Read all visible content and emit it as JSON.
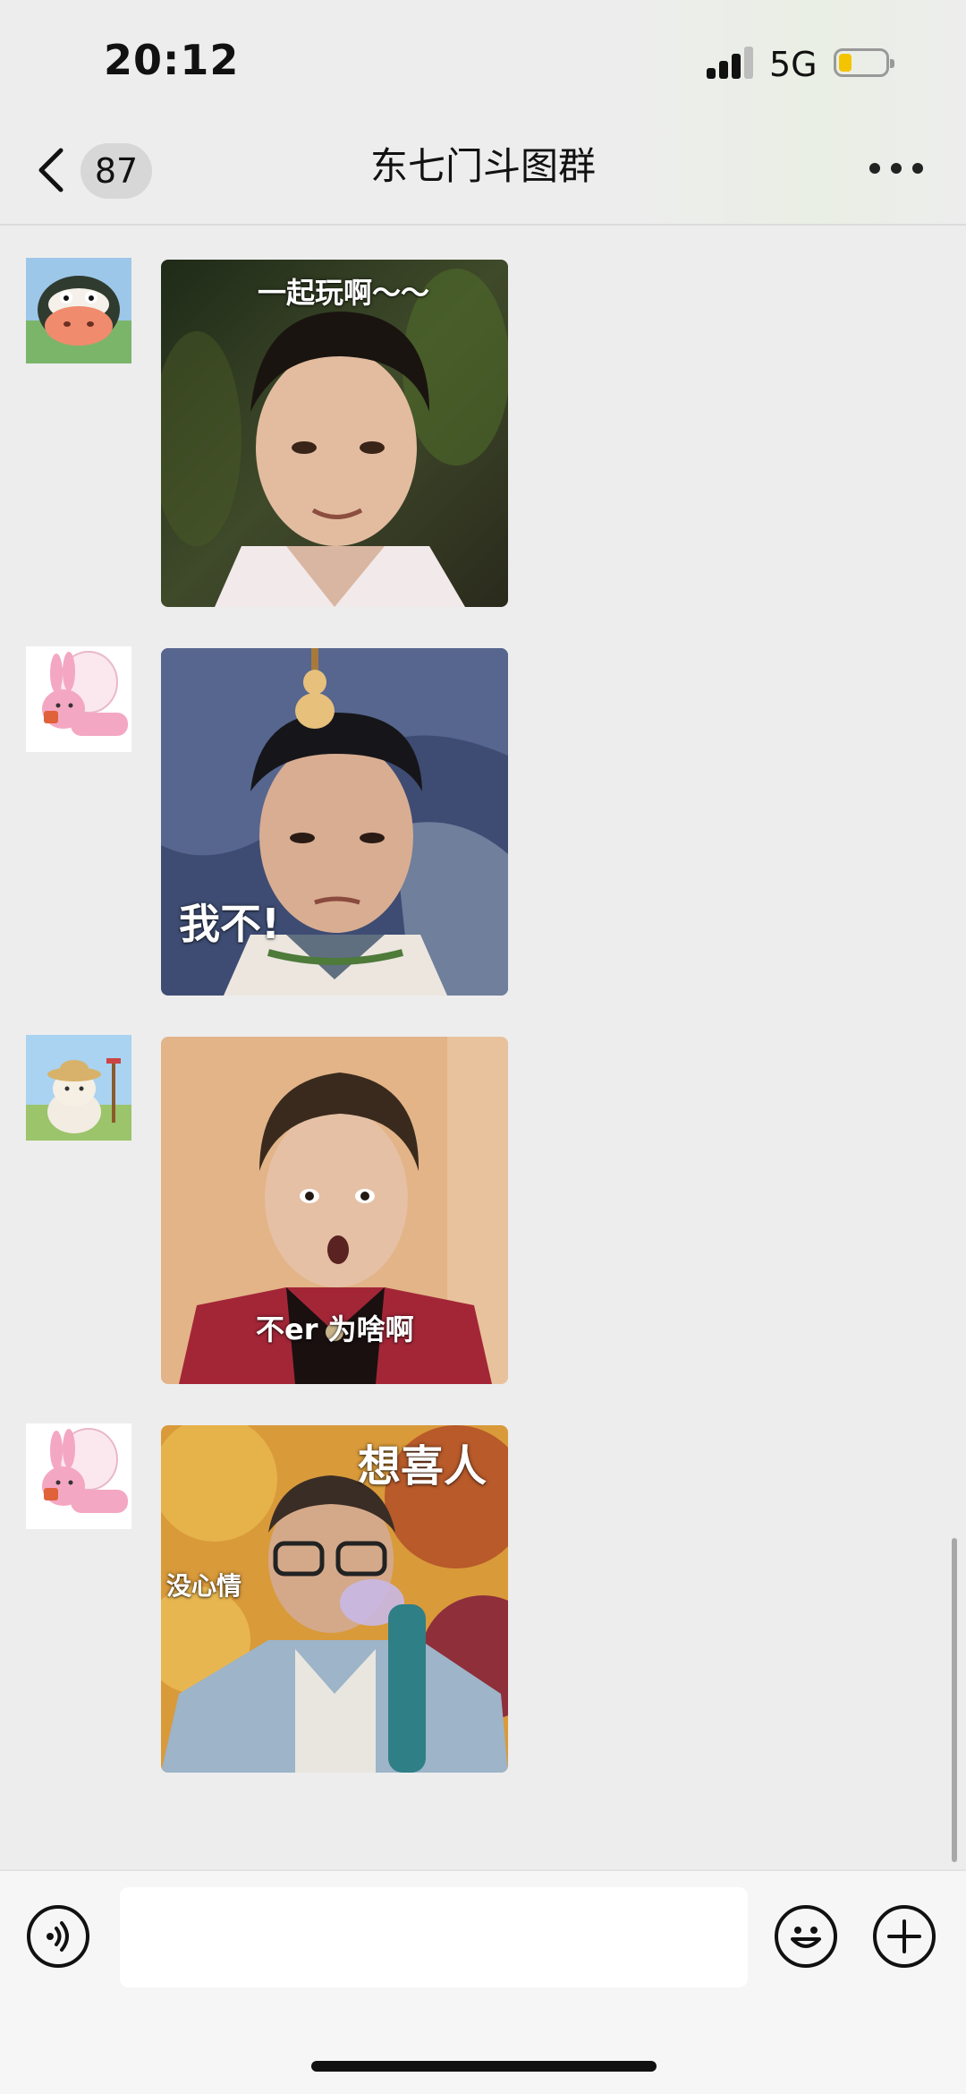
{
  "status": {
    "time": "20:12",
    "network": "5G",
    "battery_color": "#f5c400"
  },
  "header": {
    "back_icon": "chevron-left-icon",
    "unread_count": "87",
    "title": "东七门斗图群",
    "more_icon": "ellipsis-icon"
  },
  "messages": [
    {
      "avatar": "cow-avatar",
      "caption": "一起玩啊～～"
    },
    {
      "avatar": "pink-rabbit-avatar",
      "caption": "我不!"
    },
    {
      "avatar": "cat-farmer-avatar",
      "caption": "不er 为啥啊"
    },
    {
      "avatar": "pink-rabbit-avatar",
      "caption": "想喜人",
      "caption2": "没心情"
    }
  ],
  "input_bar": {
    "voice_icon": "voice-icon",
    "placeholder": "",
    "emoji_icon": "emoji-icon",
    "plus_icon": "plus-icon"
  }
}
